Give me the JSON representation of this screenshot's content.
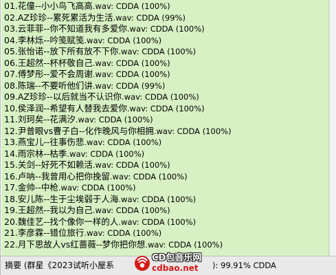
{
  "tracks": [
    {
      "title": "01.花僮--小小鸟飞高高",
      "ext": ".wav",
      "format": ": CDDA (100%)"
    },
    {
      "title": "02.AZ珍珍--累死累活为生活",
      "ext": ".wav",
      "format": ": CDDA (99%)"
    },
    {
      "title": "03.云菲菲--你不知道我有多爱你",
      "ext": ".wav",
      "format": ": CDDA (100%)"
    },
    {
      "title": "04.李林烁--吟笺赋笺",
      "ext": ".wav",
      "format": ": CDDA (100%)"
    },
    {
      "title": "05.张怡诺--放下所有放不下你",
      "ext": ".wav",
      "format": ": CDDA (100%)"
    },
    {
      "title": "06.王超然--杯杯敬自己",
      "ext": ".wav",
      "format": ": CDDA (100%)"
    },
    {
      "title": "07.傅梦彤--爱不会周谢",
      "ext": ".wav",
      "format": ": CDDA (100%)"
    },
    {
      "title": "08.陈瑞--不要听他们讲",
      "ext": ".wav",
      "format": ": CDDA (99%)"
    },
    {
      "title": "09.AZ珍珍--以后就当不认识你",
      "ext": ".wav",
      "format": ": CDDA (100%)"
    },
    {
      "title": "10.侯泽润--希望有人替我去爱你",
      "ext": ".wav",
      "format": ": CDDA (100%)"
    },
    {
      "title": "11.刘珂矣--花满汐",
      "ext": ".wav",
      "format": ": CDDA (100%)"
    },
    {
      "title": "12.尹普眼vs曹子白--化作晚风与你相拥",
      "ext": ".wav",
      "format": ": CDDA (100%)"
    },
    {
      "title": "13.燕宝儿--往事伤悲",
      "ext": ".wav",
      "format": ": CDDA (100%)"
    },
    {
      "title": "14.雨宗林--枯季",
      "ext": ".wav",
      "format": ": CDDA (100%)"
    },
    {
      "title": "15.关剑--好死不如赖活",
      "ext": ".wav",
      "format": ": CDDA (100%)"
    },
    {
      "title": "16.卢呐--我曾用心把你挽留",
      "ext": ".wav",
      "format": ": CDDA (100%)"
    },
    {
      "title": "17.金帅--中枪",
      "ext": ".wav",
      "format": ": CDDA (100%)"
    },
    {
      "title": "18.安儿陈--生于尘埃弱于人海",
      "ext": ".wav",
      "format": ": CDDA (100%)"
    },
    {
      "title": "19.王超然--我以为自己",
      "ext": ".wav",
      "format": ": CDDA (100%)"
    },
    {
      "title": "20.魏佳艺--找个像你一样的人",
      "ext": ".wav",
      "format": ": CDDA (100%)"
    },
    {
      "title": "21.李彦霖--错位旅行",
      "ext": ".wav",
      "format": ": CDDA (100%)"
    },
    {
      "title": "22.月下思故人vs红蔷薇--梦你把你想",
      "ext": ".wav",
      "format": ": CDDA (100%)"
    }
  ],
  "status": {
    "summary_prefix": "摘要 (群星《2023试听小屋系",
    "summary_suffix": "): 99.91% CDDA"
  },
  "watermark": {
    "cn_text": "CD包音乐网",
    "domain_text": "cdbao.net"
  },
  "colors": {
    "list_bg": "#d7f1c4",
    "watermark_red": "#d51a1a"
  }
}
